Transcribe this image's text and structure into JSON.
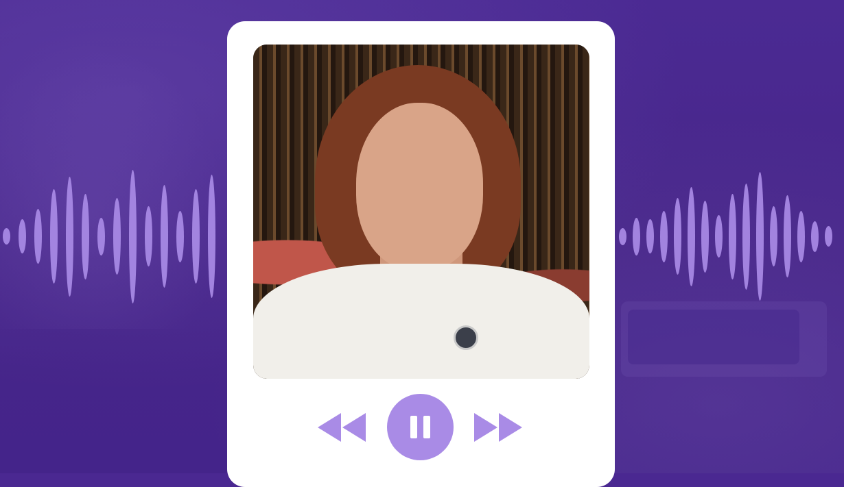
{
  "player": {
    "accent_color": "#a98be6",
    "background_color": "#4a2891",
    "card_color": "#ffffff",
    "state": "playing",
    "controls": {
      "rewind": {
        "icon": "rewind-icon"
      },
      "play_pause": {
        "icon": "pause-icon"
      },
      "forward": {
        "icon": "fast-forward-icon"
      }
    }
  },
  "waveform": {
    "left_levels": [
      0.08,
      0.2,
      0.32,
      0.55,
      0.7,
      0.5,
      0.22,
      0.45,
      0.78,
      0.35,
      0.6,
      0.3,
      0.55,
      0.72
    ],
    "right_levels": [
      0.1,
      0.22,
      0.2,
      0.3,
      0.45,
      0.58,
      0.42,
      0.25,
      0.5,
      0.62,
      0.75,
      0.35,
      0.48,
      0.3,
      0.18,
      0.12
    ]
  }
}
